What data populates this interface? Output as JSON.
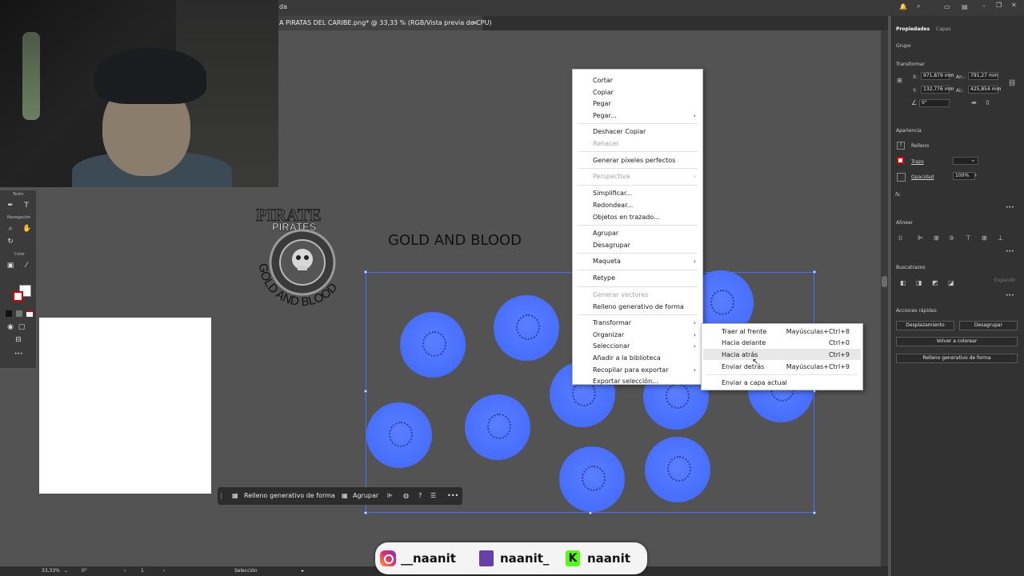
{
  "document_tab": {
    "title": "A PIRATAS DEL CARIBE.png* @ 33,33 % (RGB/Vista previa de CPU)",
    "close": "×",
    "menu_fragment": "da"
  },
  "left_toolbar": {
    "headers": [
      "Texto",
      "Navegación",
      "Color"
    ]
  },
  "canvas": {
    "logo_text": {
      "top": "PIRATES",
      "side": "GOLD AND BLOOD",
      "big": "PIRATE"
    },
    "heading": "GOLD AND BLOOD"
  },
  "context_toolbar": {
    "generative_fill": "Relleno generativo de forma",
    "group": "Agrupar",
    "more": "•••"
  },
  "context_menu": {
    "items": [
      {
        "label": "Cortar",
        "disabled": false,
        "submenu": false
      },
      {
        "label": "Copiar",
        "disabled": false,
        "submenu": false
      },
      {
        "label": "Pegar",
        "disabled": false,
        "submenu": false
      },
      {
        "label": "Pegar...",
        "disabled": false,
        "submenu": true
      },
      {
        "label": "Deshacer Copiar",
        "disabled": false,
        "submenu": false
      },
      {
        "label": "Rehacer",
        "disabled": true,
        "submenu": false
      },
      {
        "label": "Generar píxeles perfectos",
        "disabled": false,
        "submenu": false
      },
      {
        "label": "Perspectiva",
        "disabled": true,
        "submenu": true
      },
      {
        "label": "Simplificar...",
        "disabled": false,
        "submenu": false
      },
      {
        "label": "Redondear...",
        "disabled": false,
        "submenu": false
      },
      {
        "label": "Objetos en trazado...",
        "disabled": false,
        "submenu": false
      },
      {
        "label": "Agrupar",
        "disabled": false,
        "submenu": false
      },
      {
        "label": "Desagrupar",
        "disabled": false,
        "submenu": false
      },
      {
        "label": "Maqueta",
        "disabled": false,
        "submenu": true
      },
      {
        "label": "Retype",
        "disabled": false,
        "submenu": false
      },
      {
        "label": "Generar vectores",
        "disabled": true,
        "submenu": false
      },
      {
        "label": "Relleno generativo de forma",
        "disabled": false,
        "submenu": false
      },
      {
        "label": "Transformar",
        "disabled": false,
        "submenu": true
      },
      {
        "label": "Organizar",
        "disabled": false,
        "submenu": true
      },
      {
        "label": "Seleccionar",
        "disabled": false,
        "submenu": true
      },
      {
        "label": "Añadir a la biblioteca",
        "disabled": false,
        "submenu": false
      },
      {
        "label": "Recopilar para exportar",
        "disabled": false,
        "submenu": true
      },
      {
        "label": "Exportar selección...",
        "disabled": false,
        "submenu": false
      }
    ],
    "arrow": "›"
  },
  "submenu": {
    "items": [
      {
        "label": "Traer al frente",
        "shortcut": "Mayúsculas+Ctrl+8"
      },
      {
        "label": "Hacia delante",
        "shortcut": "Ctrl+0"
      },
      {
        "label": "Hacia atrás",
        "shortcut": "Ctrl+9"
      },
      {
        "label": "Enviar detrás",
        "shortcut": "Mayúsculas+Ctrl+9"
      },
      {
        "label": "Enviar a capa actual",
        "shortcut": ""
      }
    ]
  },
  "right_panel": {
    "tabs": [
      "Propiedades",
      "Capas"
    ],
    "group_label": "Grupo",
    "transform": {
      "title": "Transformar",
      "x_label": "X:",
      "x": "971,879 mm",
      "y_label": "Y:",
      "y": "132,776 mm",
      "w_label": "An.:",
      "w": "791,27 mm",
      "h_label": "Al.:",
      "h": "425,854 mm",
      "angle": "0°"
    },
    "appearance": {
      "title": "Apariencia",
      "fill": "Relleno",
      "stroke": "Trazo",
      "opacity_label": "Opacidad",
      "opacity": "100%",
      "fx": "fx."
    },
    "align_title": "Alinear",
    "pathfinder": {
      "title": "Buscatrazos",
      "expand": "Expandir"
    },
    "quick_actions": {
      "title": "Acciones rápidas",
      "offset": "Desplazamiento",
      "ungroup": "Desagrupar",
      "recolor": "Volver a colorear",
      "generative_fill": "Relleno generativo de forma"
    },
    "more": "•••"
  },
  "status_bar": {
    "zoom": "33,33%",
    "rotation": "0°",
    "artboard": "1",
    "tool": "Selección"
  },
  "social": {
    "instagram": "__naanit",
    "twitch": "naanit_",
    "kick": "naanit",
    "kick_letter": "K"
  },
  "colors": {
    "canvas_bg": "#535353",
    "selection": "#4a6fff",
    "coin_blue": "#4b72ff",
    "kick_green": "#53fc18",
    "twitch_purple": "#6441a5"
  }
}
